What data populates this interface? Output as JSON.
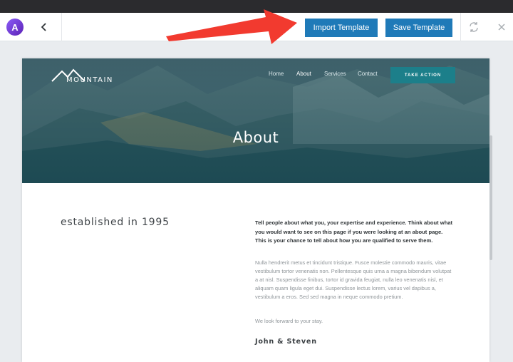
{
  "toolbar": {
    "logo_letter": "A",
    "import_label": "Import Template",
    "save_label": "Save Template",
    "icons": {
      "back": "chevron-left-icon",
      "refresh": "refresh-icon",
      "close": "close-icon"
    },
    "button_color": "#1f7ab8"
  },
  "annotation": {
    "arrow_color": "#f23a2f"
  },
  "site": {
    "brand": "MOUNTAIN",
    "nav": {
      "home": "Home",
      "about": "About",
      "services": "Services",
      "contact": "Contact"
    },
    "cta": "TAKE ACTION",
    "hero_title": "About",
    "cta_color": "#1c7f8a"
  },
  "content": {
    "established": "established in 1995",
    "intro": "Tell people about what you, your expertise and experience.  Think about what you would want to see on this page if you were looking at an about page.  This is your chance to tell about how you are qualified to serve them.",
    "body": "Nulla hendrerit metus et tincidunt tristique. Fusce molestie commodo mauris, vitae vestibulum tortor venenatis non. Pellentesque quis urna a magna bibendum volutpat a at nisl. Suspendisse finibus, tortor id gravida feugiat, nulla leo venenatis nisl, et aliquam quam ligula eget dui. Suspendisse lectus lorem, varius vel dapibus a, vestibulum a eros. Sed sed magna in neque commodo pretium.",
    "forward": "We look forward to your stay.",
    "signature": "John & Steven"
  }
}
